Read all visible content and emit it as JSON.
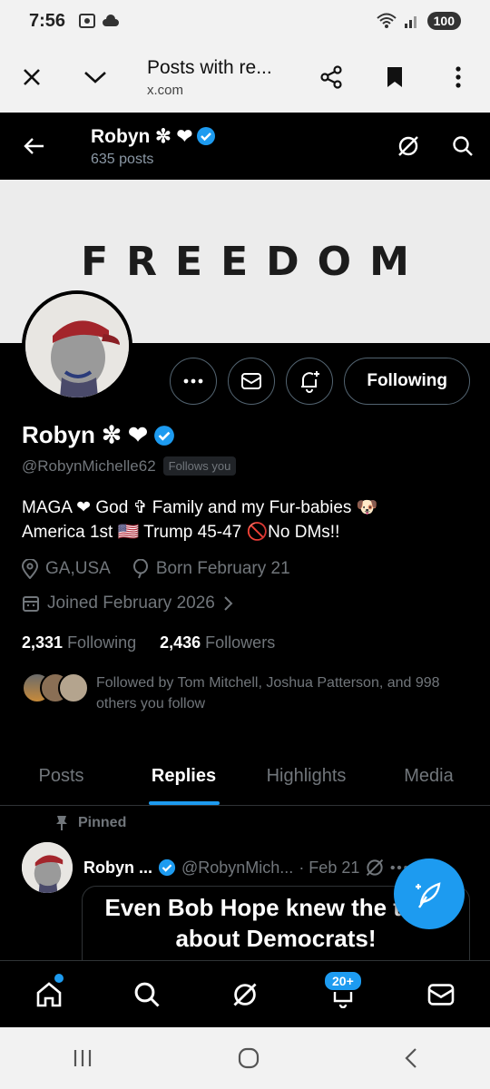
{
  "status_bar": {
    "time": "7:56",
    "battery": "100"
  },
  "tab_header": {
    "title": "Posts with re...",
    "url": "x.com"
  },
  "profile_nav": {
    "name": "Robyn ✼ ❤",
    "posts_count": "635 posts"
  },
  "banner": {
    "text": "FREEDOM"
  },
  "actions": {
    "following_label": "Following"
  },
  "profile": {
    "name": "Robyn ✼ ❤",
    "handle": "@RobynMichelle62",
    "follows_you": "Follows you",
    "bio_line1": "MAGA ❤ God ✞ Family and my Fur-babies 🐶",
    "bio_line2": "America 1st 🇺🇸 Trump 45-47 🚫No DMs!!",
    "location": "GA,USA",
    "birthday": "Born February 21",
    "joined": "Joined February 2026",
    "following_count": "2,331",
    "following_label": "Following",
    "followers_count": "2,436",
    "followers_label": "Followers",
    "followed_by": "Followed by Tom Mitchell, Joshua Patterson, and 998 others you follow"
  },
  "tabs": [
    "Posts",
    "Replies",
    "Highlights",
    "Media"
  ],
  "post": {
    "pinned_label": "Pinned",
    "name": "Robyn ...",
    "handle": "@RobynMich...",
    "date": "· Feb 21",
    "media_text": "Even Bob Hope knew the truth about Democrats!",
    "emojis": "😊😊😊😊😊😊😊"
  },
  "bottom_nav": {
    "notifications_badge": "20+"
  },
  "colors": {
    "accent": "#1d9bf0",
    "background": "#000000",
    "muted": "#71767b"
  }
}
